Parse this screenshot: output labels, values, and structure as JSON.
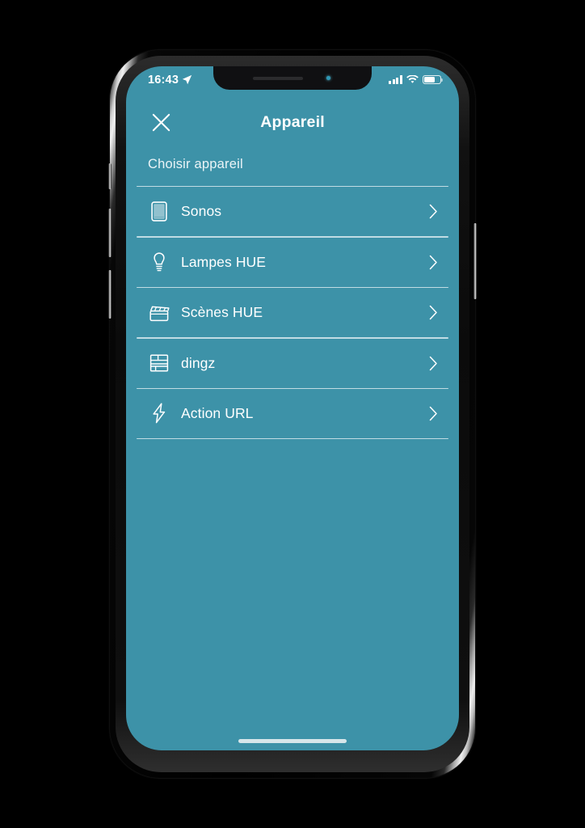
{
  "theme": {
    "screen_bg": "#3d92a8",
    "text_color": "#ffffff",
    "divider_color": "#d8e9ee"
  },
  "status_bar": {
    "time": "16:43",
    "location_icon": "location-arrow-icon",
    "signal_icon": "cellular-signal-icon",
    "signal_bars": 4,
    "wifi_icon": "wifi-icon",
    "battery_icon": "battery-icon",
    "battery_level_pct": 68
  },
  "navbar": {
    "close_icon": "close-x-icon",
    "title": "Appareil"
  },
  "content": {
    "section_label": "Choisir appareil",
    "items": [
      {
        "label": "Sonos",
        "icon": "speaker-grille-icon",
        "chevron": "chevron-right-icon"
      },
      {
        "label": "Lampes HUE",
        "icon": "light-bulb-icon",
        "chevron": "chevron-right-icon"
      },
      {
        "label": "Scènes HUE",
        "icon": "clapperboard-icon",
        "chevron": "chevron-right-icon"
      },
      {
        "label": "dingz",
        "icon": "wall-switch-panel-icon",
        "chevron": "chevron-right-icon"
      },
      {
        "label": "Action URL",
        "icon": "lightning-bolt-icon",
        "chevron": "chevron-right-icon"
      }
    ]
  },
  "home_indicator": "home-indicator-bar"
}
